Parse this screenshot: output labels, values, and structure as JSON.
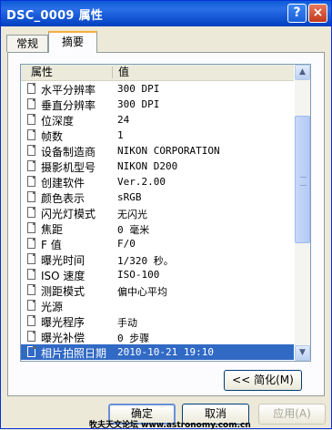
{
  "window": {
    "title": "DSC_0009 属性",
    "help_label": "?",
    "close_label": "×"
  },
  "tabs": [
    "常规",
    "摘要"
  ],
  "list": {
    "header_property": "属性",
    "header_value": "值",
    "rows": [
      {
        "name": "水平分辨率",
        "value": "300 DPI"
      },
      {
        "name": "垂直分辨率",
        "value": "300 DPI"
      },
      {
        "name": "位深度",
        "value": "24"
      },
      {
        "name": "帧数",
        "value": "1"
      },
      {
        "name": "设备制造商",
        "value": "NIKON CORPORATION"
      },
      {
        "name": "摄影机型号",
        "value": "NIKON D200"
      },
      {
        "name": "创建软件",
        "value": "Ver.2.00"
      },
      {
        "name": "颜色表示",
        "value": "sRGB"
      },
      {
        "name": "闪光灯模式",
        "value": "无闪光"
      },
      {
        "name": "焦距",
        "value": "0 毫米"
      },
      {
        "name": "F 值",
        "value": "F/0"
      },
      {
        "name": "曝光时间",
        "value": "1/320 秒。"
      },
      {
        "name": "ISO 速度",
        "value": "ISO-100"
      },
      {
        "name": "测距模式",
        "value": "偏中心平均"
      },
      {
        "name": "光源",
        "value": ""
      },
      {
        "name": "曝光程序",
        "value": "手动"
      },
      {
        "name": "曝光补偿",
        "value": "0 步骤"
      },
      {
        "name": "相片拍照日期",
        "value": "2010-10-21 19:10"
      }
    ]
  },
  "buttons": {
    "simplify": "<< 简化(M)",
    "ok": "确定",
    "cancel": "取消",
    "apply": "应用(A)"
  },
  "watermark": "牧夫天文论坛 www.astronomy.com.cn"
}
